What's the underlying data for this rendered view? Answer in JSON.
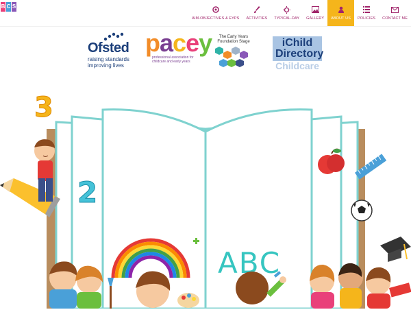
{
  "brand": {
    "letters": [
      "B",
      "C",
      "S"
    ],
    "colors": [
      "#e9407a",
      "#4aa0d8",
      "#8a58b8"
    ]
  },
  "nav": {
    "items": [
      {
        "label": "AIM-OBJECTIVES & EYPS",
        "icon": "target-icon"
      },
      {
        "label": "ACTIVITIES",
        "icon": "brush-icon"
      },
      {
        "label": "TYPICAL-DAY",
        "icon": "sun-icon"
      },
      {
        "label": "GALLERY",
        "icon": "image-icon"
      },
      {
        "label": "ABOUT US",
        "icon": "user-icon",
        "active": true
      },
      {
        "label": "POLICIES",
        "icon": "list-icon"
      },
      {
        "label": "CONTACT ME",
        "icon": "mail-icon"
      }
    ],
    "accent": "#a0246a",
    "active_bg": "#f5b51b"
  },
  "partners": {
    "ofsted": {
      "name": "Ofsted",
      "tagline1": "raising standards",
      "tagline2": "improving lives"
    },
    "pacey": {
      "letters": [
        "p",
        "a",
        "c",
        "e",
        "y"
      ],
      "colors": [
        "#f28c28",
        "#7a3f91",
        "#f5b51b",
        "#e9407a",
        "#6bbf3e"
      ],
      "tagline1": "professional association for",
      "tagline2": "childcare and early years"
    },
    "eyfs": {
      "title1": "The Early Years",
      "title2": "Foundation Stage"
    },
    "ichild": {
      "line1": "iChild",
      "line2": "Directory",
      "line3": "Childcare"
    }
  },
  "hero": {
    "board_text": "ABC",
    "numbers": [
      "3",
      "2"
    ]
  }
}
